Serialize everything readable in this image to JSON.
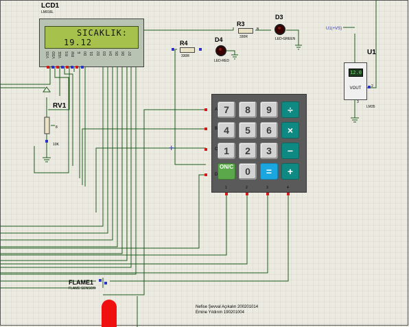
{
  "lcd": {
    "ref": "LCD1",
    "model": "LM016L",
    "line1": "SICAKLIK:",
    "line2": "19.12",
    "pins": [
      "VSS",
      "VDD",
      "VEE",
      "RS",
      "RW",
      "E",
      "D0",
      "D1",
      "D2",
      "D3",
      "D4",
      "D5",
      "D6",
      "D7"
    ]
  },
  "rv1": {
    "ref": "RV1",
    "value": "10K",
    "pin": "8"
  },
  "r3": {
    "ref": "R3",
    "value": "330R"
  },
  "r4": {
    "ref": "R4",
    "value": "330R"
  },
  "d3": {
    "ref": "D3",
    "model": "LED-GREEN"
  },
  "d4": {
    "ref": "D4",
    "model": "LED-RED"
  },
  "u1": {
    "ref": "U1",
    "model": "LM35",
    "display": "12.0",
    "vout": "VOUT",
    "pin2": "2",
    "pin3": "3",
    "supply": "U1(+VS)"
  },
  "keypad": {
    "rows": [
      "A",
      "B",
      "C",
      "D"
    ],
    "cols": [
      "1",
      "2",
      "3",
      "4"
    ],
    "keys": [
      {
        "label": "7",
        "kind": "num"
      },
      {
        "label": "8",
        "kind": "num"
      },
      {
        "label": "9",
        "kind": "num"
      },
      {
        "label": "÷",
        "kind": "op"
      },
      {
        "label": "4",
        "kind": "num"
      },
      {
        "label": "5",
        "kind": "num"
      },
      {
        "label": "6",
        "kind": "num"
      },
      {
        "label": "×",
        "kind": "op"
      },
      {
        "label": "1",
        "kind": "num"
      },
      {
        "label": "2",
        "kind": "num"
      },
      {
        "label": "3",
        "kind": "num"
      },
      {
        "label": "−",
        "kind": "op"
      },
      {
        "label": "ON/C",
        "kind": "on"
      },
      {
        "label": "0",
        "kind": "num"
      },
      {
        "label": "=",
        "kind": "eq"
      },
      {
        "label": "+",
        "kind": "op"
      }
    ]
  },
  "flame": {
    "ref": "FLAME1",
    "model": "FLAME SENSOR"
  },
  "authors": {
    "line1": "Nefise Şevval Açıkalın 200201014",
    "line2": "Emine Yıldırım 190201004"
  },
  "colors": {
    "wire": "#1a5a1a",
    "pin_red": "#d21a1a",
    "pin_blue": "#2b32c8",
    "lcd_screen": "#a6c24d",
    "keypad_op": "#0f8a83",
    "keypad_eq": "#1aa7e0",
    "keypad_on": "#5aa84a",
    "flame": "#f01010"
  }
}
